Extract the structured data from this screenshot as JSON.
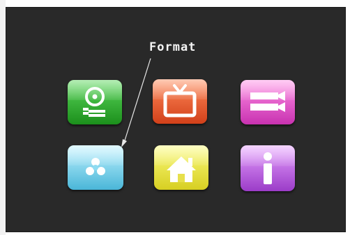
{
  "menu": {
    "callout_label": "Format",
    "items": [
      {
        "id": "tools",
        "icon": "gear-wrench-icon"
      },
      {
        "id": "tv",
        "icon": "tv-icon"
      },
      {
        "id": "video",
        "icon": "video-camera-icon"
      },
      {
        "id": "format",
        "icon": "recycle-icon"
      },
      {
        "id": "home",
        "icon": "home-icon"
      },
      {
        "id": "info",
        "icon": "info-icon"
      }
    ]
  },
  "colors": {
    "screen_background": "#292929",
    "tools": "#2fb82f",
    "tv": "#ee5a2a",
    "video": "#e659cf",
    "format": "#7fd6f0",
    "home": "#f0eb3a",
    "info": "#c26be6"
  }
}
